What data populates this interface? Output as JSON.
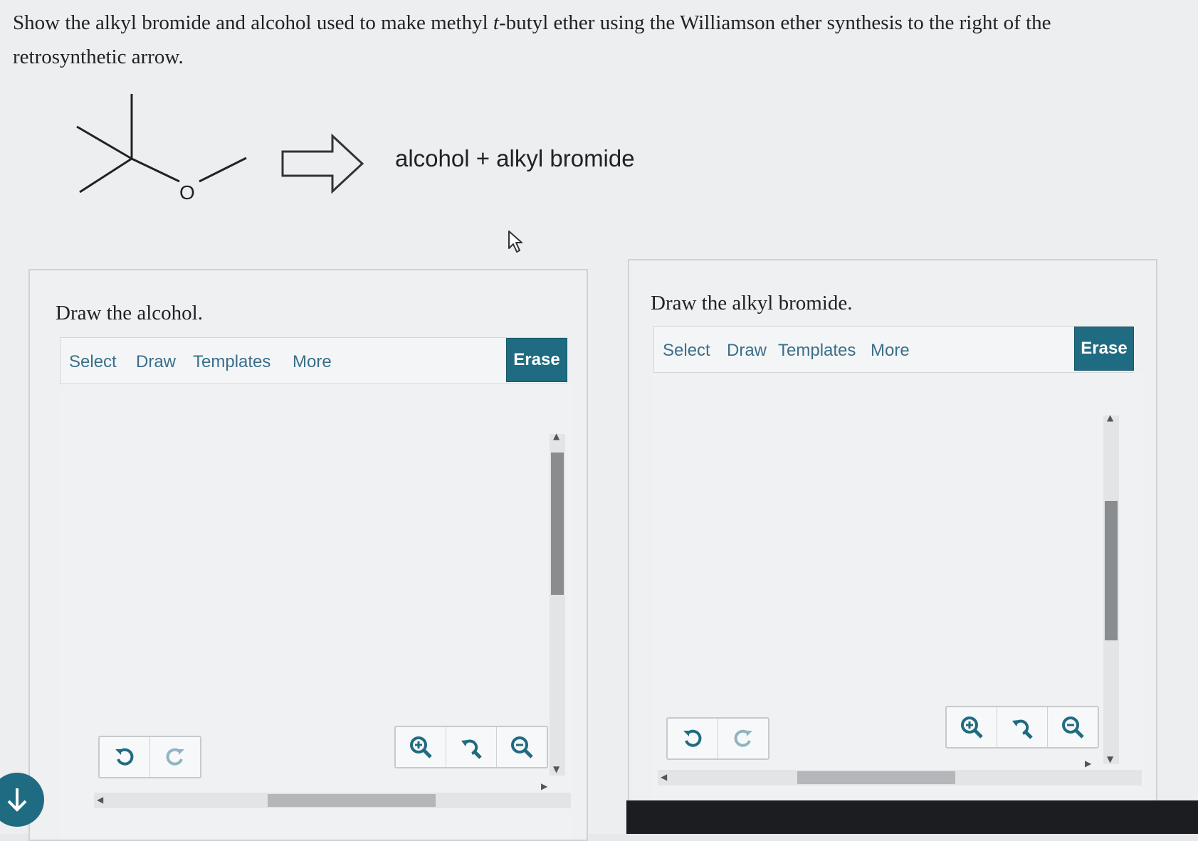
{
  "question": {
    "part1": "Show the alkyl bromide and alcohol used to make methyl ",
    "italic": "t",
    "part2": "-butyl ether using the Williamson ether synthesis to the right of the retrosynthetic arrow."
  },
  "reaction": {
    "oxygen_label": "O",
    "products_text": "alcohol + alkyl bromide"
  },
  "panels": [
    {
      "title": "Draw the alcohol.",
      "toolbar": {
        "select": "Select",
        "draw": "Draw",
        "templates": "Templates",
        "more": "More",
        "erase": "Erase"
      }
    },
    {
      "title": "Draw the alkyl bromide.",
      "toolbar": {
        "select": "Select",
        "draw": "Draw",
        "templates": "Templates",
        "more": "More",
        "erase": "Erase"
      }
    }
  ],
  "colors": {
    "accent": "#1f6b82",
    "link": "#3a6f8a"
  },
  "icons": [
    "undo-icon",
    "redo-icon",
    "zoom-in-icon",
    "reset-zoom-icon",
    "zoom-out-icon",
    "down-arrow-icon",
    "mouse-cursor-icon"
  ]
}
